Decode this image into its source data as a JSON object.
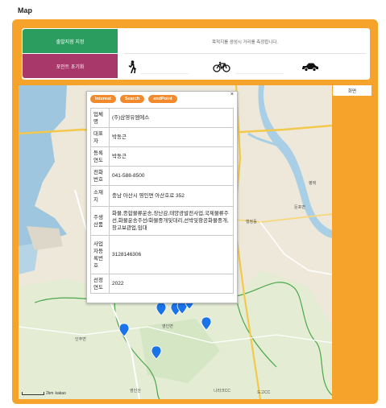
{
  "page": {
    "title": "Map"
  },
  "controls": {
    "start_button": "출발지점 지정",
    "reset_button": "포인트 초기화",
    "info_message": "목적지를 생성시 거리를 측정합니다.",
    "modes": [
      {
        "icon": "walk-icon",
        "value": ""
      },
      {
        "icon": "bike-icon",
        "value": ""
      },
      {
        "icon": "car-icon",
        "value": ""
      }
    ]
  },
  "side_tab": {
    "label": "화면"
  },
  "popup": {
    "tabs": [
      "Interest",
      "Search",
      "endPoint"
    ],
    "close_label": "×",
    "rows": [
      {
        "key": "업체명",
        "value": "(주)삼영유엠에스"
      },
      {
        "key": "대표자",
        "value": "박동근"
      },
      {
        "key": "등록연도",
        "value": "박동근"
      },
      {
        "key": "전화번호",
        "value": "041-588-8500"
      },
      {
        "key": "소재지",
        "value": "충남 아산시 영인면 아산호로 352"
      },
      {
        "key": "주생산품",
        "value": "화물,종합물류운송,장난감,태양광발전사업,국제물류주선,화물운송주선/화물중개및대리,선박및항공화물중개,창고보관업,임대"
      },
      {
        "key": "사업자등록번호",
        "value": "3128146306"
      },
      {
        "key": "선정연도",
        "value": "2022"
      }
    ]
  },
  "map": {
    "labels": [
      "영인면",
      "인주면",
      "행정동",
      "둔포면",
      "평택",
      "영인산",
      "나라크CC",
      "도고CC"
    ],
    "scale_label": "2km",
    "attribution": "kakao"
  },
  "colors": {
    "frame": "#f5a32b",
    "start": "#2a9d5f",
    "reset": "#a8386a",
    "tab": "#f28a2c",
    "marker": "#1a73e8"
  }
}
